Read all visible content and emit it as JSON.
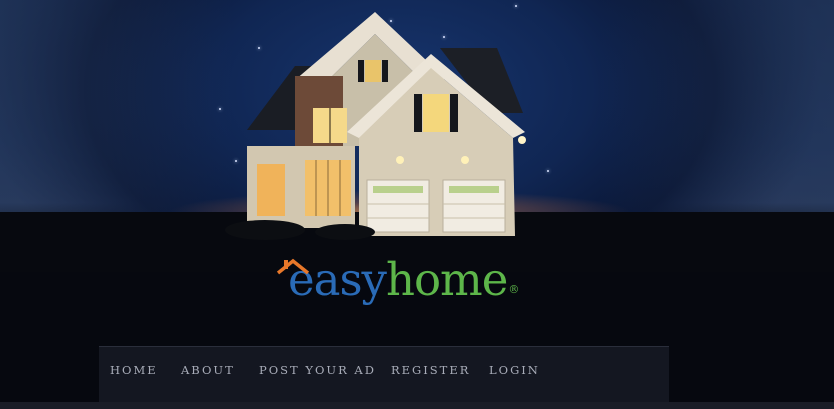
{
  "brand": {
    "easy": "easy",
    "home": "home",
    "registered_mark": "®",
    "colors": {
      "easy": "#2a6bb7",
      "home": "#5db64a",
      "roof": "#e8782a"
    }
  },
  "hero": {
    "image": "house-at-night"
  },
  "nav": {
    "items": [
      {
        "label": "HOME"
      },
      {
        "label": "ABOUT"
      },
      {
        "label": "POST YOUR AD"
      },
      {
        "label": "REGISTER"
      },
      {
        "label": "LOGIN"
      }
    ]
  }
}
